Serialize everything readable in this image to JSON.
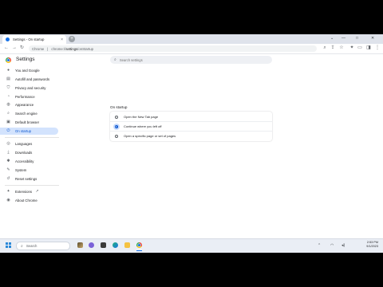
{
  "browser": {
    "tab_title": "Settings - On startup",
    "tab_close_glyph": "×",
    "new_tab_glyph": "+",
    "window_controls": [
      "⌄",
      "—",
      "□",
      "✕"
    ],
    "nav_glyphs": {
      "back": "←",
      "forward": "→",
      "reload": "↻"
    },
    "omnibox_site_chip": "Chrome",
    "url_scheme": "chrome://",
    "url_host": "settings",
    "url_path": "/onStartup",
    "toolbar_icon_glyphs": [
      "⌕",
      "⇪",
      "☆",
      "✦",
      "▭",
      "◨",
      "⋮"
    ]
  },
  "settings": {
    "title": "Settings",
    "search_placeholder": "Search settings",
    "search_glyph": "⌕",
    "nav_group1": [
      {
        "label": "You and Google",
        "icon": "person-icon",
        "glyph": "●"
      },
      {
        "label": "Autofill and passwords",
        "icon": "clipboard-key-icon",
        "glyph": "▤"
      },
      {
        "label": "Privacy and security",
        "icon": "shield-icon",
        "glyph": "⛉"
      },
      {
        "label": "Performance",
        "icon": "speedometer-icon",
        "glyph": "◔"
      },
      {
        "label": "Appearance",
        "icon": "palette-icon",
        "glyph": "◍"
      },
      {
        "label": "Search engine",
        "icon": "search-icon",
        "glyph": "⌕"
      },
      {
        "label": "Default browser",
        "icon": "browser-icon",
        "glyph": "▣"
      },
      {
        "label": "On startup",
        "icon": "power-icon",
        "glyph": "⏻",
        "active": true
      }
    ],
    "nav_group2": [
      {
        "label": "Languages",
        "icon": "globe-icon",
        "glyph": "◎"
      },
      {
        "label": "Downloads",
        "icon": "download-icon",
        "glyph": "⤓"
      },
      {
        "label": "Accessibility",
        "icon": "accessibility-icon",
        "glyph": "✱"
      },
      {
        "label": "System",
        "icon": "wrench-icon",
        "glyph": "✎"
      },
      {
        "label": "Reset settings",
        "icon": "reset-icon",
        "glyph": "↺"
      }
    ],
    "nav_group3": [
      {
        "label": "Extensions",
        "icon": "puzzle-icon",
        "glyph": "✦",
        "external_glyph": "↗"
      },
      {
        "label": "About Chrome",
        "icon": "chrome-icon",
        "glyph": "◉"
      }
    ],
    "section_title": "On startup",
    "startup_options": [
      {
        "label": "Open the New Tab page",
        "selected": false
      },
      {
        "label": "Continue where you left off",
        "selected": true
      },
      {
        "label": "Open a specific page or set of pages",
        "selected": false
      }
    ]
  },
  "taskbar": {
    "search_label": "Search",
    "search_glyph": "⌕",
    "time": "2:53 PM",
    "date": "9/1/2023",
    "tray_glyphs": [
      "⌃",
      "◠",
      "◂)"
    ],
    "accent_color": "#1a73e8"
  },
  "colors": {
    "accent": "#0b57d0",
    "active_nav_bg": "#d3e3fd",
    "tabstrip_bg": "#dfe3eb"
  }
}
